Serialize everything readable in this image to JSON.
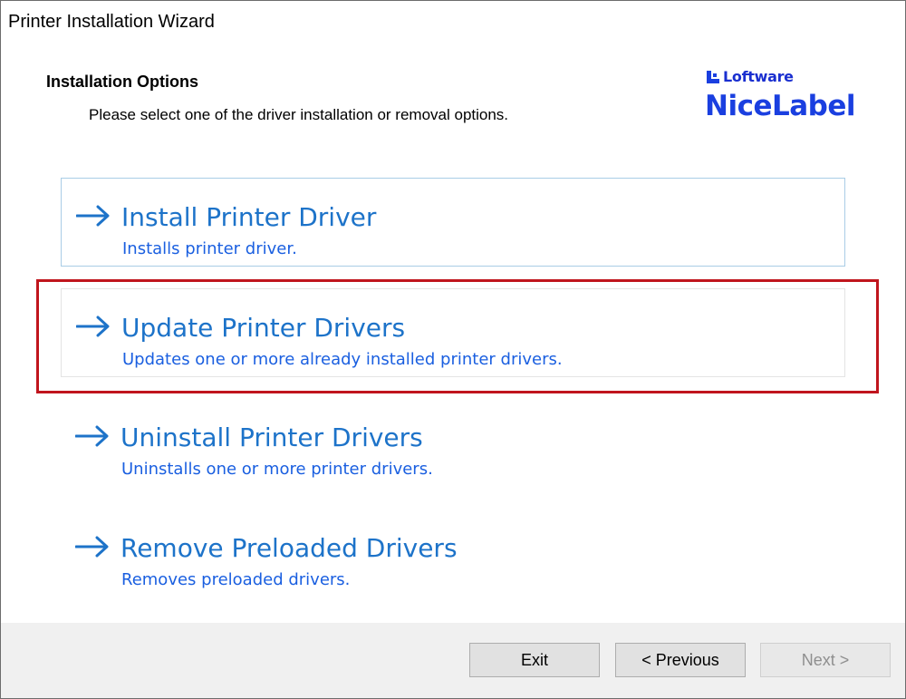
{
  "window": {
    "title": "Printer Installation Wizard"
  },
  "header": {
    "title": "Installation Options",
    "subtitle": "Please select one of the driver installation or removal options.",
    "logo_brand": "Loftware",
    "logo_product": "NiceLabel"
  },
  "options": [
    {
      "title": "Install Printer Driver",
      "description": "Installs printer driver."
    },
    {
      "title": "Update Printer Drivers",
      "description": "Updates one or more already installed printer drivers."
    },
    {
      "title": "Uninstall Printer Drivers",
      "description": "Uninstalls one or more printer drivers."
    },
    {
      "title": "Remove Preloaded Drivers",
      "description": "Removes preloaded drivers."
    }
  ],
  "footer": {
    "exit_label": "Exit",
    "previous_label": "< Previous",
    "next_label": "Next >"
  },
  "colors": {
    "option_title": "#1d73c9",
    "option_desc": "#1a5fe0",
    "highlight": "#c0151d",
    "logo": "#1a3fe0"
  },
  "icons": {
    "option_arrow": "right-arrow-icon"
  }
}
